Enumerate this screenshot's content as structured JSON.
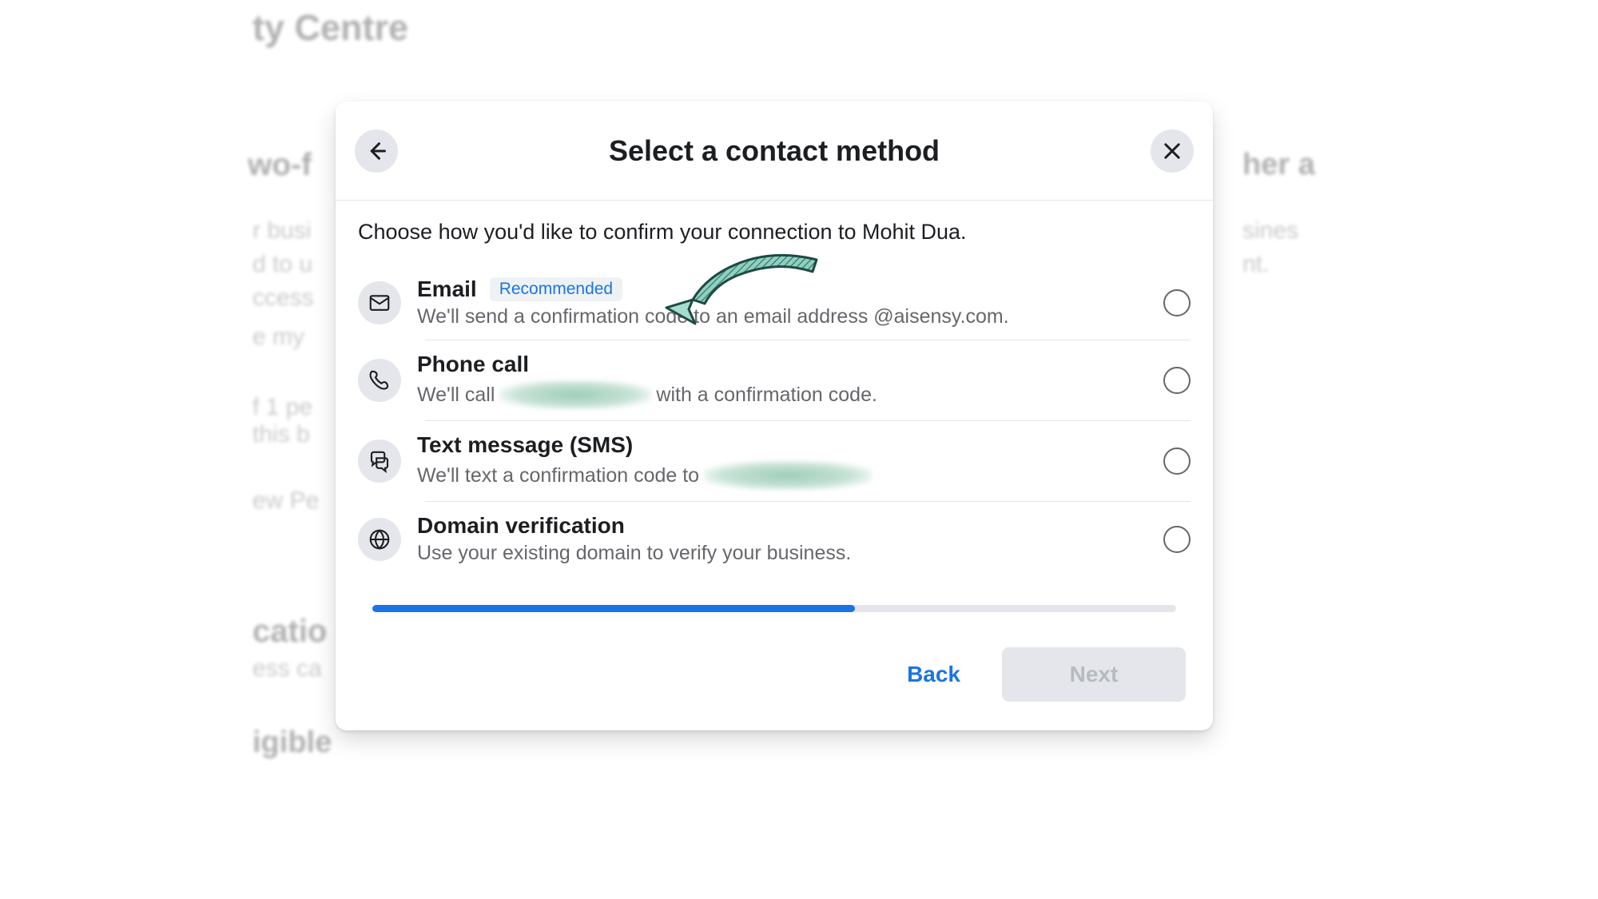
{
  "background": {
    "title_fragment": "ty Centre",
    "sub1_fragment": "wo-f",
    "right_heading_fragment": "her a",
    "para_left": "r busi\nd to u\nccess",
    "para_right": "sines\nnt.",
    "txt2": "e my",
    "txt3": "f 1 pe\n this b",
    "txt4": "ew Pe",
    "sub2_fragment": "catio",
    "txt5": "ess ca",
    "sub3_fragment": "igible"
  },
  "modal": {
    "title": "Select a contact method",
    "instruction": "Choose how you'd like to confirm your connection to Mohit Dua.",
    "options": [
      {
        "title": "Email",
        "badge": "Recommended",
        "desc": "We'll send a confirmation code to an email address @aisensy.com."
      },
      {
        "title": "Phone call",
        "desc_prefix": "We'll call ",
        "desc_suffix": " with a confirmation code."
      },
      {
        "title": "Text message (SMS)",
        "desc_prefix": "We'll text a confirmation code to "
      },
      {
        "title": "Domain verification",
        "desc": "Use your existing domain to verify your business."
      }
    ],
    "progress_percent": 60,
    "buttons": {
      "back": "Back",
      "next": "Next"
    }
  }
}
